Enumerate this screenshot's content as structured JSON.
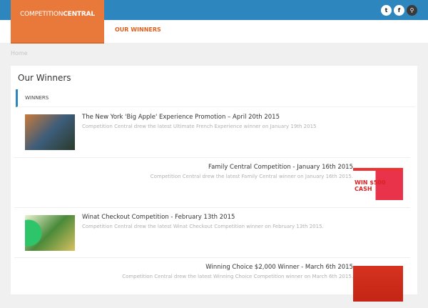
{
  "header": {
    "logo_light": "COMPETITION",
    "logo_bold": "CENTRAL",
    "nav": "OUR WINNERS",
    "icons": [
      "twitter-icon",
      "facebook-icon",
      "search-icon"
    ]
  },
  "breadcrumb": "Home",
  "page": {
    "title": "Our Winners",
    "tab": "WINNERS"
  },
  "items": [
    {
      "title": "The New York 'Big Apple' Experience Promotion – April 20th 2015",
      "desc": "Competition Central drew the latest Ultimate French Experience winner on January 19th 2015"
    },
    {
      "title": "Family Central Competition - January 16th 2015",
      "desc": "Competition Central drew the latest Family Central winner on January 16th 2015.",
      "thumb_text": "WIN $500 CASH"
    },
    {
      "title": "Winat Checkout Competition - February 13th 2015",
      "desc": "Competition Central drew the latest Winat Checkout Competition winner on February 13th 2015."
    },
    {
      "title": "Winning Choice $2,000 Winner - March 6th 2015",
      "desc": "Competition Central drew the latest Winning Choice Competition winner on March 6th 2015."
    }
  ]
}
